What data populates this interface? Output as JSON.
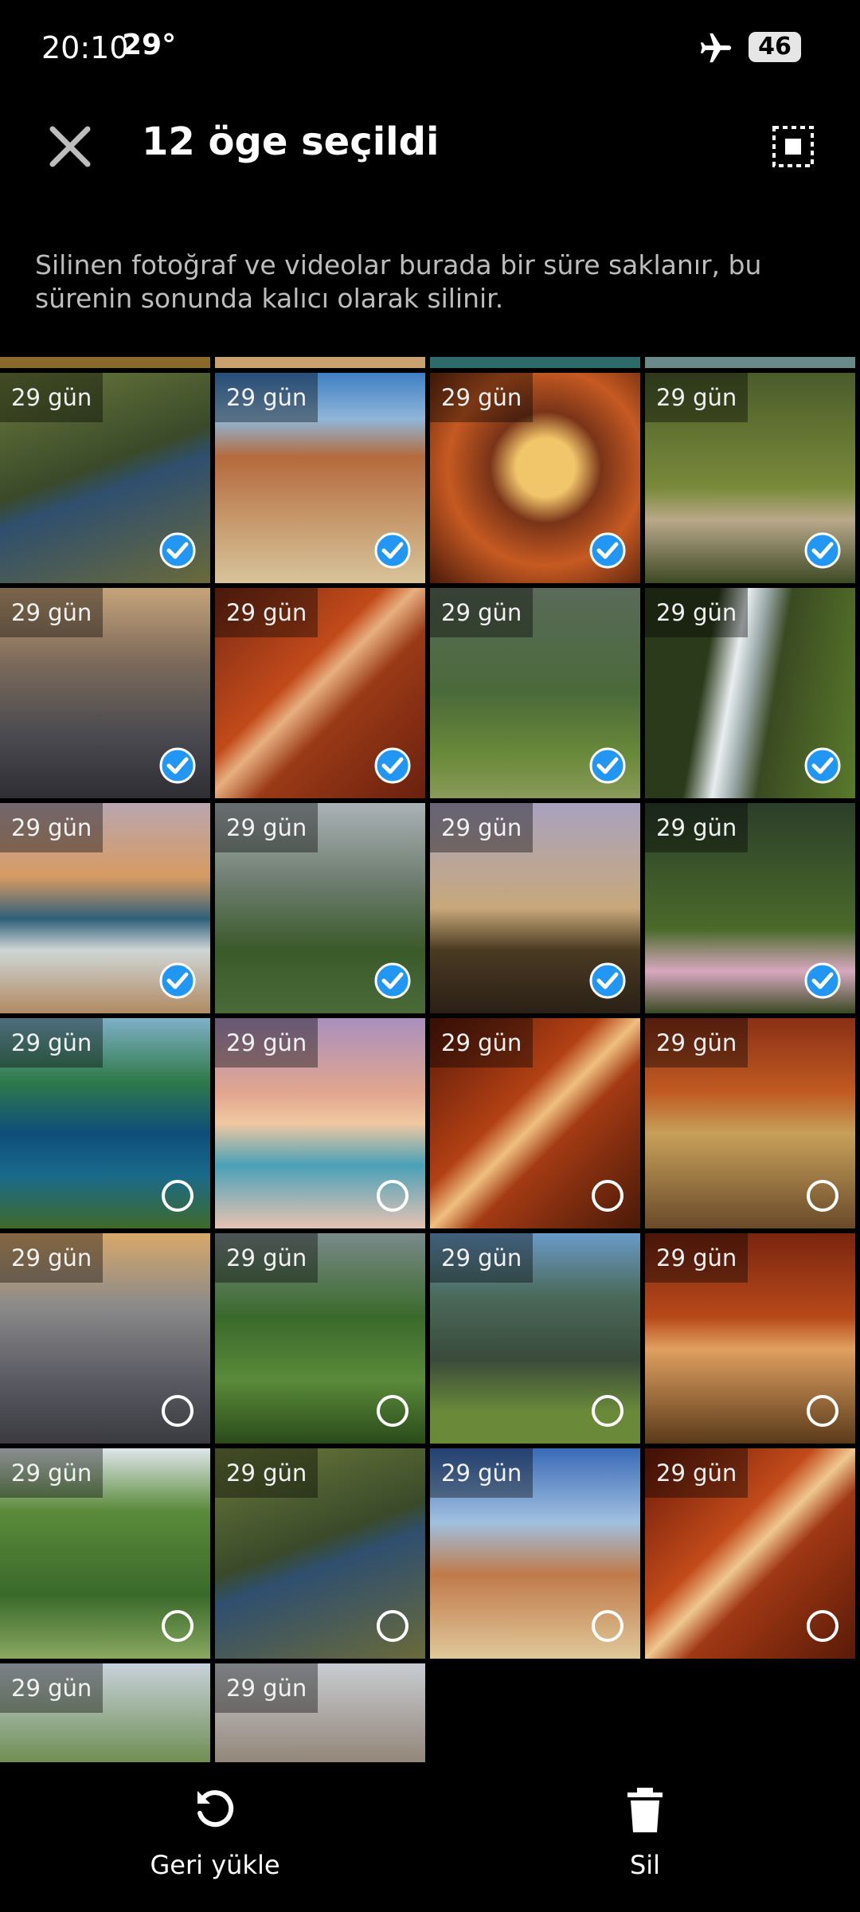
{
  "status": {
    "time": "20:10",
    "temperature": "29°",
    "battery": "46"
  },
  "header": {
    "title": "12 öge seçildi"
  },
  "info": {
    "text": "Silinen fotoğraf ve videolar burada bir süre saklanır, bu sürenin sonunda kalıcı olarak silinir."
  },
  "items": [
    {
      "days": "29 gün",
      "selected": true
    },
    {
      "days": "29 gün",
      "selected": true
    },
    {
      "days": "29 gün",
      "selected": true
    },
    {
      "days": "29 gün",
      "selected": true
    },
    {
      "days": "29 gün",
      "selected": true
    },
    {
      "days": "29 gün",
      "selected": true
    },
    {
      "days": "29 gün",
      "selected": true
    },
    {
      "days": "29 gün",
      "selected": true
    },
    {
      "days": "29 gün",
      "selected": true
    },
    {
      "days": "29 gün",
      "selected": true
    },
    {
      "days": "29 gün",
      "selected": true
    },
    {
      "days": "29 gün",
      "selected": true
    },
    {
      "days": "29 gün",
      "selected": false
    },
    {
      "days": "29 gün",
      "selected": false
    },
    {
      "days": "29 gün",
      "selected": false
    },
    {
      "days": "29 gün",
      "selected": false
    },
    {
      "days": "29 gün",
      "selected": false
    },
    {
      "days": "29 gün",
      "selected": false
    },
    {
      "days": "29 gün",
      "selected": false
    },
    {
      "days": "29 gün",
      "selected": false
    },
    {
      "days": "29 gün",
      "selected": false
    },
    {
      "days": "29 gün",
      "selected": false
    },
    {
      "days": "29 gün",
      "selected": false
    },
    {
      "days": "29 gün",
      "selected": false
    },
    {
      "days": "29 gün",
      "selected": false
    },
    {
      "days": "29 gün",
      "selected": false
    }
  ],
  "actions": {
    "restore": "Geri yükle",
    "delete": "Sil"
  },
  "colors": {
    "accent": "#2196f3",
    "background": "#000000"
  }
}
